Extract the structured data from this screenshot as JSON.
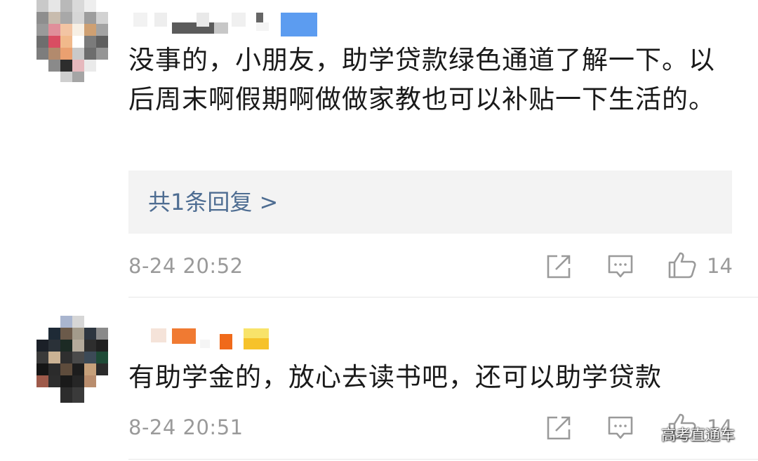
{
  "comments": [
    {
      "text": "没事的，小朋友，助学贷款绿色通道了解一下。以后周末啊假期啊做做家教也可以补贴一下生活的。",
      "reply_link": "共1条回复 >",
      "time": "8-24 20:52",
      "likes": "14",
      "icons": {
        "share": "share-icon",
        "comment": "comment-icon",
        "like": "thumbs-up-icon"
      }
    },
    {
      "text": "有助学金的，放心去读书吧，还可以助学贷款",
      "time": "8-24 20:51",
      "likes": "14",
      "icons": {
        "share": "share-icon",
        "comment": "comment-icon",
        "like": "thumbs-up-icon"
      }
    }
  ],
  "watermark": "高考直通车",
  "colors": {
    "text": "#1a1a1a",
    "meta": "#9a9a9a",
    "link": "#4e6d92",
    "reply_bg": "#f3f3f3",
    "divider": "#e7e7e7"
  }
}
